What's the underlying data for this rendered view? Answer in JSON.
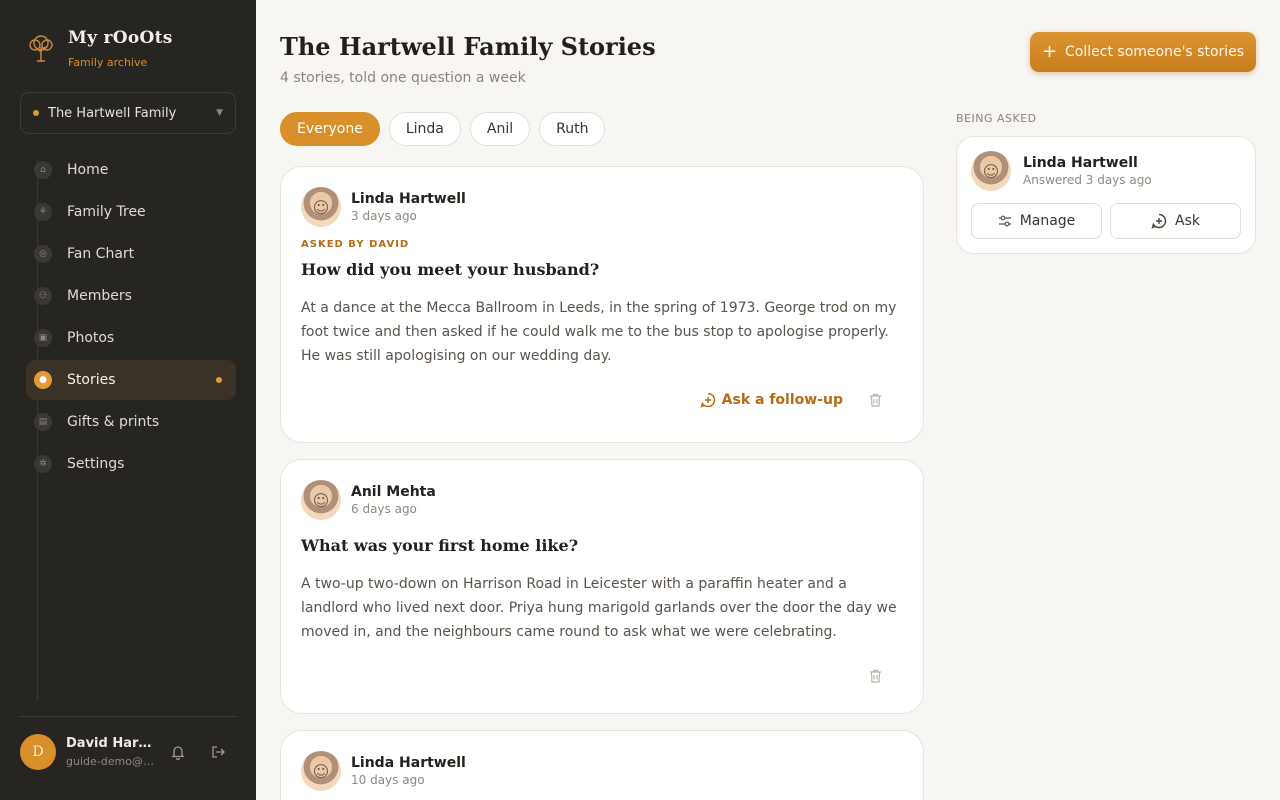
{
  "brand": {
    "name": "My rOoOts",
    "subtitle": "Family archive"
  },
  "family_select": {
    "value": "The Hartwell Family"
  },
  "nav": [
    {
      "label": "Home",
      "icon": "home-icon",
      "active": false
    },
    {
      "label": "Family Tree",
      "icon": "tree-icon",
      "active": false
    },
    {
      "label": "Fan Chart",
      "icon": "fan-chart-icon",
      "active": false
    },
    {
      "label": "Members",
      "icon": "members-icon",
      "active": false
    },
    {
      "label": "Photos",
      "icon": "photos-icon",
      "active": false
    },
    {
      "label": "Stories",
      "icon": "microphone-icon",
      "active": true
    },
    {
      "label": "Gifts & prints",
      "icon": "gift-icon",
      "active": false
    },
    {
      "label": "Settings",
      "icon": "settings-icon",
      "active": false
    }
  ],
  "user": {
    "initial": "D",
    "name": "David Hartwell",
    "email": "guide-demo@example.com"
  },
  "header": {
    "title": "The Hartwell Family Stories",
    "subtitle": "4 stories, told one question a week",
    "collect_button": "Collect someone's stories"
  },
  "filters": [
    "Everyone",
    "Linda",
    "Anil",
    "Ruth"
  ],
  "stories": [
    {
      "name": "Linda Hartwell",
      "time": "3 days ago",
      "asked_by": "ASKED BY DAVID",
      "question": "How did you meet your husband?",
      "answer": "At a dance at the Mecca Ballroom in Leeds, in the spring of 1973. George trod on my foot twice and then asked if he could walk me to the bus stop to apologise properly. He was still apologising on our wedding day.",
      "followup": "Ask a follow-up"
    },
    {
      "name": "Anil Mehta",
      "time": "6 days ago",
      "asked_by": "",
      "question": "What was your first home like?",
      "answer": "A two-up two-down on Harrison Road in Leicester with a paraffin heater and a landlord who lived next door. Priya hung marigold garlands over the door the day we moved in, and the neighbours came round to ask what we were celebrating.",
      "followup": ""
    },
    {
      "name": "Linda Hartwell",
      "time": "10 days ago"
    }
  ],
  "being_asked": {
    "label": "BEING ASKED",
    "name": "Linda Hartwell",
    "status": "Answered 3 days ago",
    "manage": "Manage",
    "ask": "Ask"
  },
  "colors": {
    "accent": "#d98f2a",
    "sidebar": "#262521",
    "accent_text": "#b46c16",
    "background": "#f7f6f3"
  }
}
